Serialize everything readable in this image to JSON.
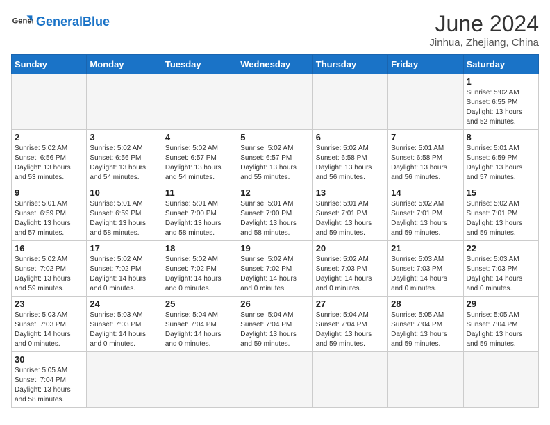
{
  "header": {
    "logo_general": "General",
    "logo_blue": "Blue",
    "month_title": "June 2024",
    "subtitle": "Jinhua, Zhejiang, China"
  },
  "weekdays": [
    "Sunday",
    "Monday",
    "Tuesday",
    "Wednesday",
    "Thursday",
    "Friday",
    "Saturday"
  ],
  "weeks": [
    [
      {
        "day": "",
        "info": ""
      },
      {
        "day": "",
        "info": ""
      },
      {
        "day": "",
        "info": ""
      },
      {
        "day": "",
        "info": ""
      },
      {
        "day": "",
        "info": ""
      },
      {
        "day": "",
        "info": ""
      },
      {
        "day": "1",
        "info": "Sunrise: 5:02 AM\nSunset: 6:55 PM\nDaylight: 13 hours\nand 52 minutes."
      }
    ],
    [
      {
        "day": "2",
        "info": "Sunrise: 5:02 AM\nSunset: 6:56 PM\nDaylight: 13 hours\nand 53 minutes."
      },
      {
        "day": "3",
        "info": "Sunrise: 5:02 AM\nSunset: 6:56 PM\nDaylight: 13 hours\nand 54 minutes."
      },
      {
        "day": "4",
        "info": "Sunrise: 5:02 AM\nSunset: 6:57 PM\nDaylight: 13 hours\nand 54 minutes."
      },
      {
        "day": "5",
        "info": "Sunrise: 5:02 AM\nSunset: 6:57 PM\nDaylight: 13 hours\nand 55 minutes."
      },
      {
        "day": "6",
        "info": "Sunrise: 5:02 AM\nSunset: 6:58 PM\nDaylight: 13 hours\nand 56 minutes."
      },
      {
        "day": "7",
        "info": "Sunrise: 5:01 AM\nSunset: 6:58 PM\nDaylight: 13 hours\nand 56 minutes."
      },
      {
        "day": "8",
        "info": "Sunrise: 5:01 AM\nSunset: 6:59 PM\nDaylight: 13 hours\nand 57 minutes."
      }
    ],
    [
      {
        "day": "9",
        "info": "Sunrise: 5:01 AM\nSunset: 6:59 PM\nDaylight: 13 hours\nand 57 minutes."
      },
      {
        "day": "10",
        "info": "Sunrise: 5:01 AM\nSunset: 6:59 PM\nDaylight: 13 hours\nand 58 minutes."
      },
      {
        "day": "11",
        "info": "Sunrise: 5:01 AM\nSunset: 7:00 PM\nDaylight: 13 hours\nand 58 minutes."
      },
      {
        "day": "12",
        "info": "Sunrise: 5:01 AM\nSunset: 7:00 PM\nDaylight: 13 hours\nand 58 minutes."
      },
      {
        "day": "13",
        "info": "Sunrise: 5:01 AM\nSunset: 7:01 PM\nDaylight: 13 hours\nand 59 minutes."
      },
      {
        "day": "14",
        "info": "Sunrise: 5:02 AM\nSunset: 7:01 PM\nDaylight: 13 hours\nand 59 minutes."
      },
      {
        "day": "15",
        "info": "Sunrise: 5:02 AM\nSunset: 7:01 PM\nDaylight: 13 hours\nand 59 minutes."
      }
    ],
    [
      {
        "day": "16",
        "info": "Sunrise: 5:02 AM\nSunset: 7:02 PM\nDaylight: 13 hours\nand 59 minutes."
      },
      {
        "day": "17",
        "info": "Sunrise: 5:02 AM\nSunset: 7:02 PM\nDaylight: 14 hours\nand 0 minutes."
      },
      {
        "day": "18",
        "info": "Sunrise: 5:02 AM\nSunset: 7:02 PM\nDaylight: 14 hours\nand 0 minutes."
      },
      {
        "day": "19",
        "info": "Sunrise: 5:02 AM\nSunset: 7:02 PM\nDaylight: 14 hours\nand 0 minutes."
      },
      {
        "day": "20",
        "info": "Sunrise: 5:02 AM\nSunset: 7:03 PM\nDaylight: 14 hours\nand 0 minutes."
      },
      {
        "day": "21",
        "info": "Sunrise: 5:03 AM\nSunset: 7:03 PM\nDaylight: 14 hours\nand 0 minutes."
      },
      {
        "day": "22",
        "info": "Sunrise: 5:03 AM\nSunset: 7:03 PM\nDaylight: 14 hours\nand 0 minutes."
      }
    ],
    [
      {
        "day": "23",
        "info": "Sunrise: 5:03 AM\nSunset: 7:03 PM\nDaylight: 14 hours\nand 0 minutes."
      },
      {
        "day": "24",
        "info": "Sunrise: 5:03 AM\nSunset: 7:03 PM\nDaylight: 14 hours\nand 0 minutes."
      },
      {
        "day": "25",
        "info": "Sunrise: 5:04 AM\nSunset: 7:04 PM\nDaylight: 14 hours\nand 0 minutes."
      },
      {
        "day": "26",
        "info": "Sunrise: 5:04 AM\nSunset: 7:04 PM\nDaylight: 13 hours\nand 59 minutes."
      },
      {
        "day": "27",
        "info": "Sunrise: 5:04 AM\nSunset: 7:04 PM\nDaylight: 13 hours\nand 59 minutes."
      },
      {
        "day": "28",
        "info": "Sunrise: 5:05 AM\nSunset: 7:04 PM\nDaylight: 13 hours\nand 59 minutes."
      },
      {
        "day": "29",
        "info": "Sunrise: 5:05 AM\nSunset: 7:04 PM\nDaylight: 13 hours\nand 59 minutes."
      }
    ],
    [
      {
        "day": "30",
        "info": "Sunrise: 5:05 AM\nSunset: 7:04 PM\nDaylight: 13 hours\nand 58 minutes."
      },
      {
        "day": "",
        "info": ""
      },
      {
        "day": "",
        "info": ""
      },
      {
        "day": "",
        "info": ""
      },
      {
        "day": "",
        "info": ""
      },
      {
        "day": "",
        "info": ""
      },
      {
        "day": "",
        "info": ""
      }
    ]
  ]
}
